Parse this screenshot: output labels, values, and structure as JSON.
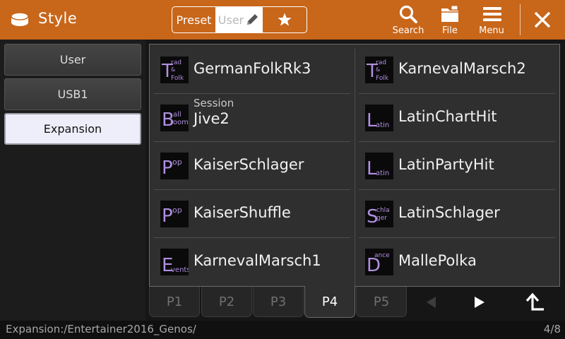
{
  "header": {
    "title": "Style",
    "tabs": {
      "preset": "Preset",
      "user": "User"
    },
    "tools": {
      "search": "Search",
      "file": "File",
      "menu": "Menu"
    },
    "accent": "#c8661a"
  },
  "locations": [
    "User",
    "USB1",
    "Expansion"
  ],
  "selected_location": "Expansion",
  "styles": {
    "left": [
      {
        "icon": "trad-folk-icon",
        "name": "GermanFolkRk3",
        "sub": ""
      },
      {
        "icon": "ballroom-icon",
        "name": "Jive2",
        "sub": "Session"
      },
      {
        "icon": "pop-icon",
        "name": "KaiserSchlager",
        "sub": ""
      },
      {
        "icon": "pop-icon",
        "name": "KaiserShuffle",
        "sub": ""
      },
      {
        "icon": "events-icon",
        "name": "KarnevalMarsch1",
        "sub": ""
      }
    ],
    "right": [
      {
        "icon": "trad-folk-icon",
        "name": "KarnevalMarsch2",
        "sub": ""
      },
      {
        "icon": "latin-icon",
        "name": "LatinChartHit",
        "sub": ""
      },
      {
        "icon": "latin-icon",
        "name": "LatinPartyHit",
        "sub": ""
      },
      {
        "icon": "schlager-icon",
        "name": "LatinSchlager",
        "sub": ""
      },
      {
        "icon": "dance-icon",
        "name": "MallePolka",
        "sub": ""
      }
    ]
  },
  "pages": [
    "P1",
    "P2",
    "P3",
    "P4",
    "P5"
  ],
  "active_page": "P4",
  "status": {
    "path": "Expansion:/Entertainer2016_Genos/",
    "page": "4/8"
  }
}
